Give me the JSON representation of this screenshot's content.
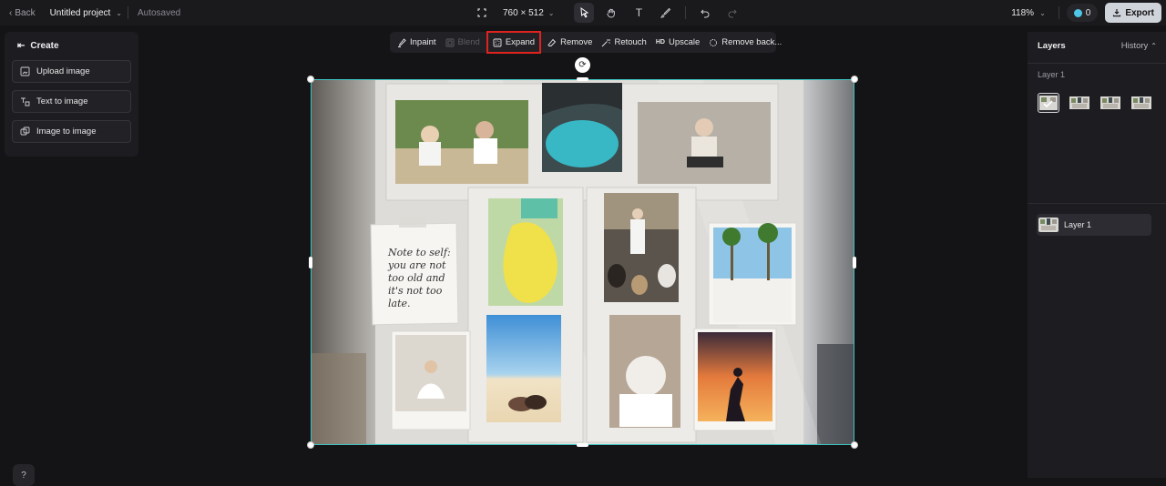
{
  "topbar": {
    "back_label": "Back",
    "project_title": "Untitled project",
    "autosave_status": "Autosaved",
    "canvas_size": "760 × 512",
    "zoom": "118%",
    "credits": "0",
    "export_label": "Export"
  },
  "left_panel": {
    "title": "Create",
    "buttons": [
      "Upload image",
      "Text to image",
      "Image to image"
    ]
  },
  "edit_toolbar": {
    "items": [
      "Inpaint",
      "Blend",
      "Expand",
      "Remove",
      "Retouch",
      "Upscale",
      "Remove back..."
    ],
    "upscale_badge": "HD"
  },
  "canvas": {
    "note_text": "Note to self: you are not too old and it's not too late."
  },
  "right_panel": {
    "layers_label": "Layers",
    "history_label": "History",
    "section_label": "Layer 1",
    "layer_item_label": "Layer 1"
  }
}
